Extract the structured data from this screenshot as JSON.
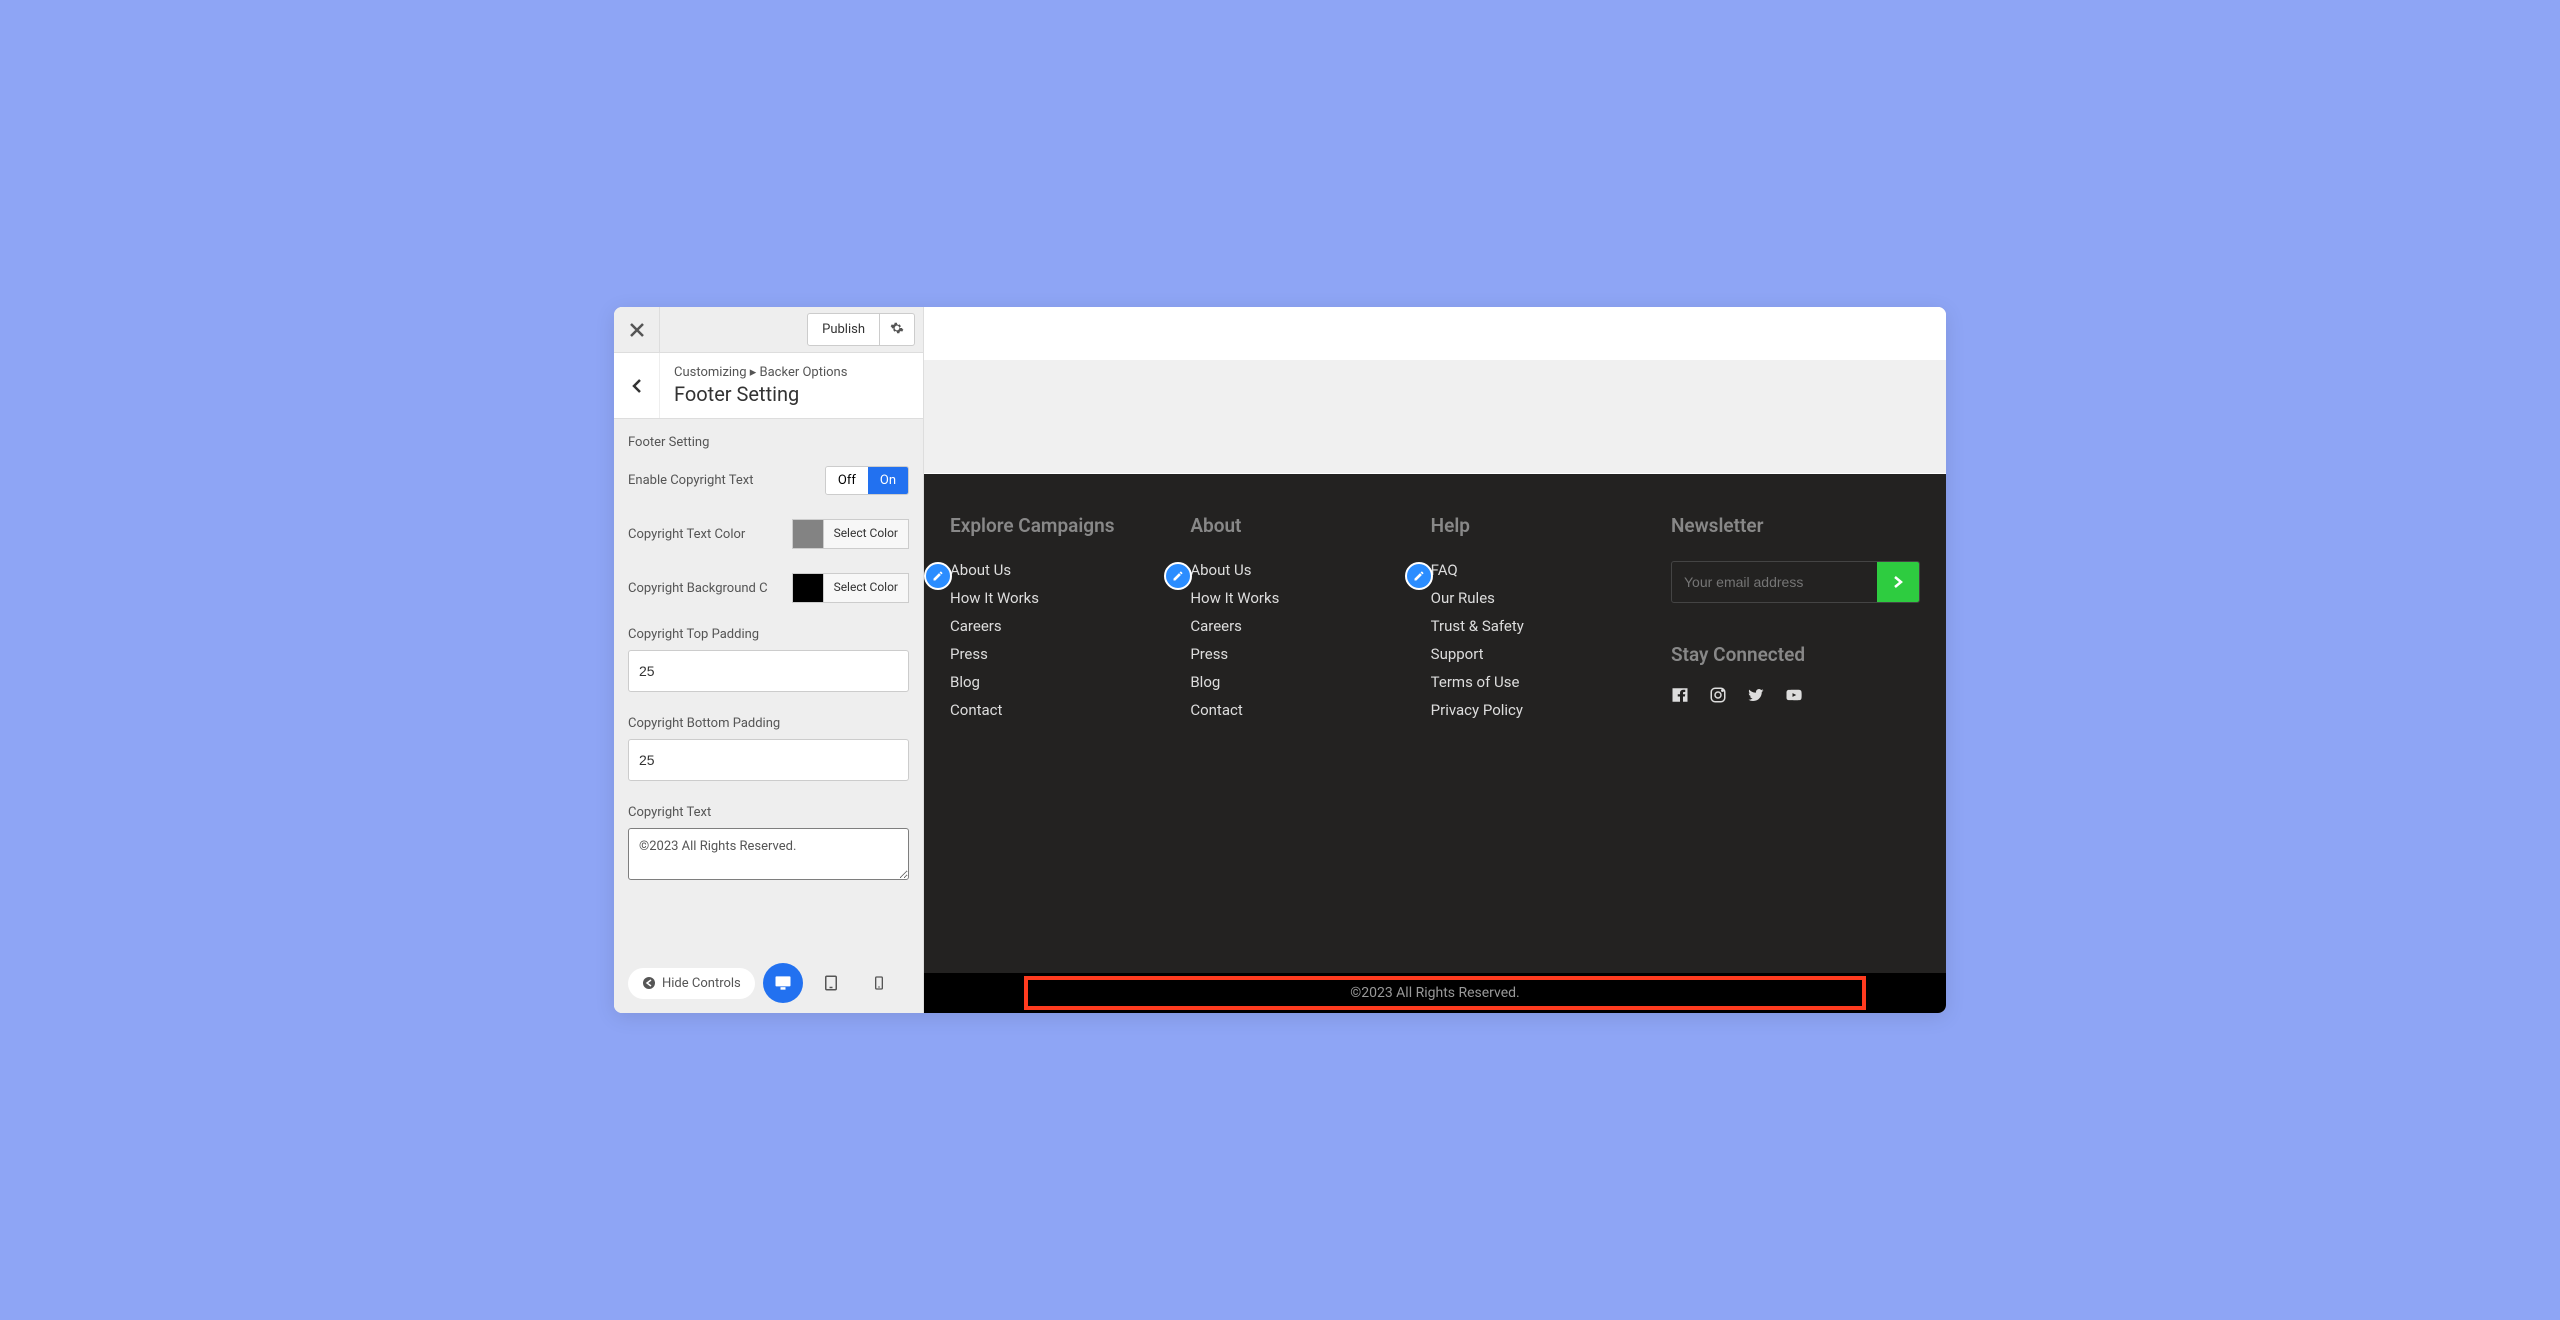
{
  "topbar": {
    "publish_label": "Publish"
  },
  "breadcrumb": {
    "path": "Customizing ▸ Backer Options",
    "title": "Footer Setting"
  },
  "settings": {
    "section_label": "Footer Setting",
    "enable_copyright_label": "Enable Copyright Text",
    "toggle_off": "Off",
    "toggle_on": "On",
    "text_color_label": "Copyright Text Color",
    "text_color_swatch": "#838383",
    "bg_color_label": "Copyright Background C",
    "bg_color_swatch": "#000000",
    "select_color_label": "Select Color",
    "top_padding_label": "Copyright Top Padding",
    "top_padding_value": "25",
    "bottom_padding_label": "Copyright Bottom Padding",
    "bottom_padding_value": "25",
    "copyright_text_label": "Copyright Text",
    "copyright_text_value": "©2023 All Rights Reserved."
  },
  "bottom": {
    "hide_controls_label": "Hide Controls"
  },
  "preview": {
    "columns": [
      {
        "title": "Explore Campaigns",
        "links": [
          "About Us",
          "How It Works",
          "Careers",
          "Press",
          "Blog",
          "Contact"
        ]
      },
      {
        "title": "About",
        "links": [
          "About Us",
          "How It Works",
          "Careers",
          "Press",
          "Blog",
          "Contact"
        ]
      },
      {
        "title": "Help",
        "links": [
          "FAQ",
          "Our Rules",
          "Trust & Safety",
          "Support",
          "Terms of Use",
          "Privacy Policy"
        ]
      }
    ],
    "newsletter_title": "Newsletter",
    "newsletter_placeholder": "Your email address",
    "stay_connected_title": "Stay Connected",
    "copyright_text": "©2023 All Rights Reserved."
  }
}
